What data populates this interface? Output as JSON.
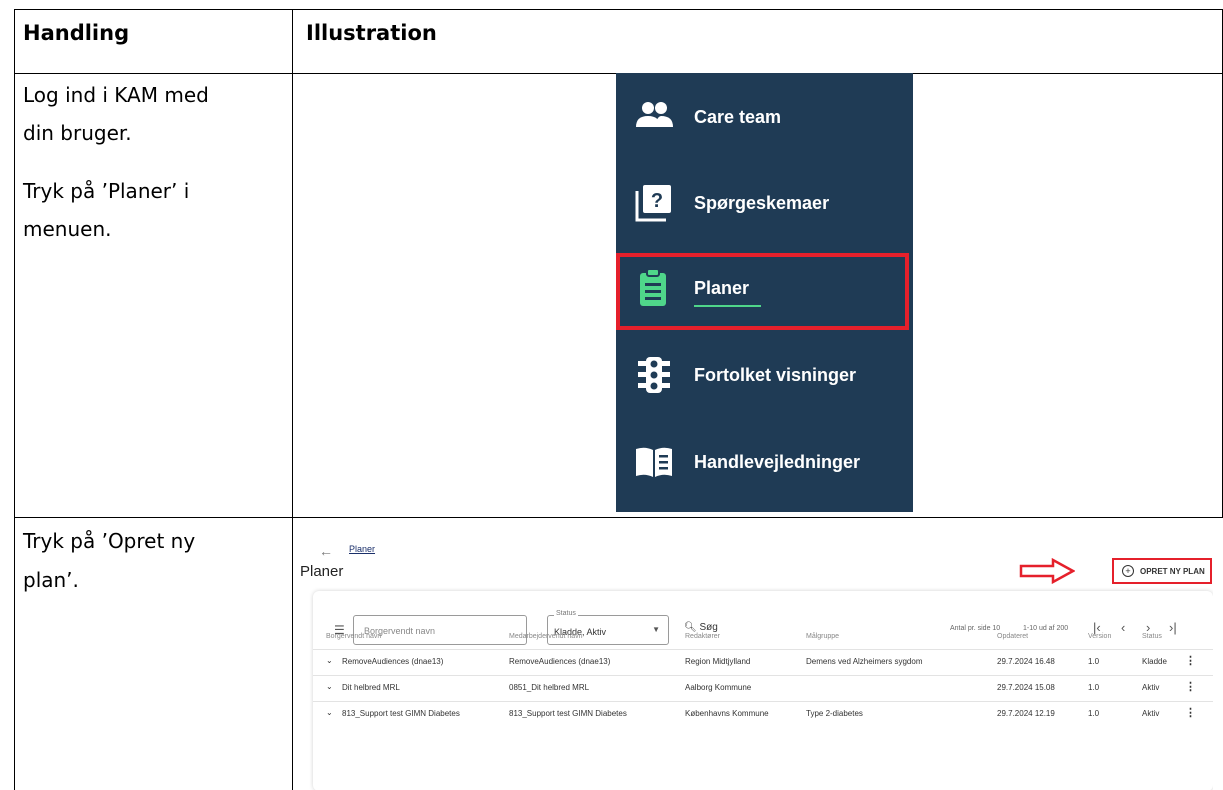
{
  "table": {
    "headers": {
      "col1": "Handling",
      "col2": "Illustration"
    },
    "row1": {
      "lines": [
        "Log ind i KAM med",
        "din bruger."
      ],
      "lines2": [
        "Tryk på ’Planer’ i",
        "menuen."
      ]
    },
    "row2": {
      "lines": [
        "Tryk på ’Opret ny",
        "plan’."
      ]
    }
  },
  "menu": {
    "background": "#1f3b55",
    "items": [
      {
        "label": "Care team",
        "icon": "people-icon"
      },
      {
        "label": "Spørgeskemaer",
        "icon": "questionnaire-icon"
      },
      {
        "label": "Planer",
        "icon": "clipboard-icon",
        "active": true
      },
      {
        "label": "Fortolket visninger",
        "icon": "traffic-light-icon"
      },
      {
        "label": "Handlevejledninger",
        "icon": "book-icon"
      }
    ],
    "highlight_color": "#e5202b",
    "active_color": "#4fd68a"
  },
  "plans": {
    "breadcrumb": "Planer",
    "title": "Planer",
    "create_button": "OPRET NY PLAN",
    "search_placeholder": "Borgervendt navn",
    "status_legend": "Status",
    "status_value": "Kladde, Aktiv",
    "search_button": "Søg",
    "page_size_label": "Antal pr. side 10",
    "page_range": "1-10 ud af 200",
    "columns": [
      "Borgervendt navn",
      "Medarbejdervendt navn",
      "Redaktører",
      "Målgruppe",
      "Opdateret",
      "Version",
      "Status"
    ],
    "rows": [
      [
        "RemoveAudiences (dnae13)",
        "RemoveAudiences (dnae13)",
        "Region Midtjylland",
        "Demens ved Alzheimers sygdom",
        "29.7.2024 16.48",
        "1.0",
        "Kladde"
      ],
      [
        "Dit helbred MRL",
        "0851_Dit helbred MRL",
        "Aalborg Kommune",
        "",
        "29.7.2024 15.08",
        "1.0",
        "Aktiv"
      ],
      [
        "813_Support test GIMN Diabetes",
        "813_Support test GIMN Diabetes",
        "Københavns Kommune",
        "Type 2-diabetes",
        "29.7.2024 12.19",
        "1.0",
        "Aktiv"
      ]
    ]
  }
}
